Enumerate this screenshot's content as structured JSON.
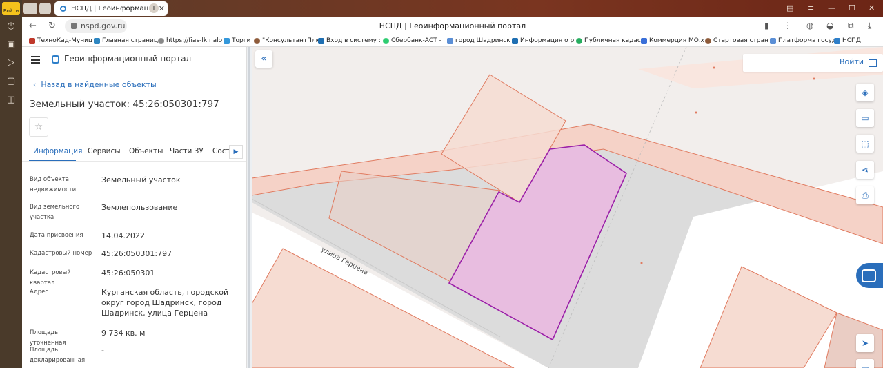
{
  "browser": {
    "login_badge": "Войти",
    "active_tab_title": "НСПД | Геоинформацио",
    "url": "nspd.gov.ru",
    "page_title": "НСПД | Геоинформационный портал",
    "bookmarks": [
      "ТехноКад-Муниц",
      "Главная страниц",
      "https://fias-lk.nalo",
      "Торги",
      "\"КонсультантПлю",
      "Вход в систему :",
      "Сбербанк-АСТ -",
      "город Шадринск",
      "Информация о р",
      "Публичная кадас",
      "Коммерция МО.х",
      "Стартовая стран",
      "Платформа госуд",
      "НСПД"
    ]
  },
  "panel": {
    "portal_title": "Геоинформационный портал",
    "back_link": "Назад в найденные объекты",
    "object_title": "Земельный участок: 45:26:050301:797",
    "tabs": [
      "Информация",
      "Сервисы",
      "Объекты",
      "Части ЗУ",
      "Соста"
    ],
    "properties": [
      {
        "label": "Вид объекта недвижимости",
        "value": "Земельный участок"
      },
      {
        "label": "Вид земельного участка",
        "value": "Землепользование"
      },
      {
        "label": "Дата присвоения",
        "value": "14.04.2022"
      },
      {
        "label": "Кадастровый номер",
        "value": "45:26:050301:797"
      },
      {
        "label": "Кадастровый квартал",
        "value": "45:26:050301"
      },
      {
        "label": "Адрес",
        "value": "Курганская область, городской округ город Шадринск, город Шадринск, улица Герцена"
      },
      {
        "label": "Площадь уточненная",
        "value": "9 734 кв. м"
      },
      {
        "label": "Площадь декларированная",
        "value": "-"
      }
    ]
  },
  "map": {
    "login_label": "Войти",
    "street_label": "улица Герцена",
    "colors": {
      "selected_fill": "#e8bde0",
      "selected_stroke": "#9b1fa8",
      "parcel_fill": "#f6dcd2",
      "parcel_stroke": "#e07a5f",
      "building_fill": "#d8d8d8",
      "accent": "#2a6ebb"
    }
  }
}
